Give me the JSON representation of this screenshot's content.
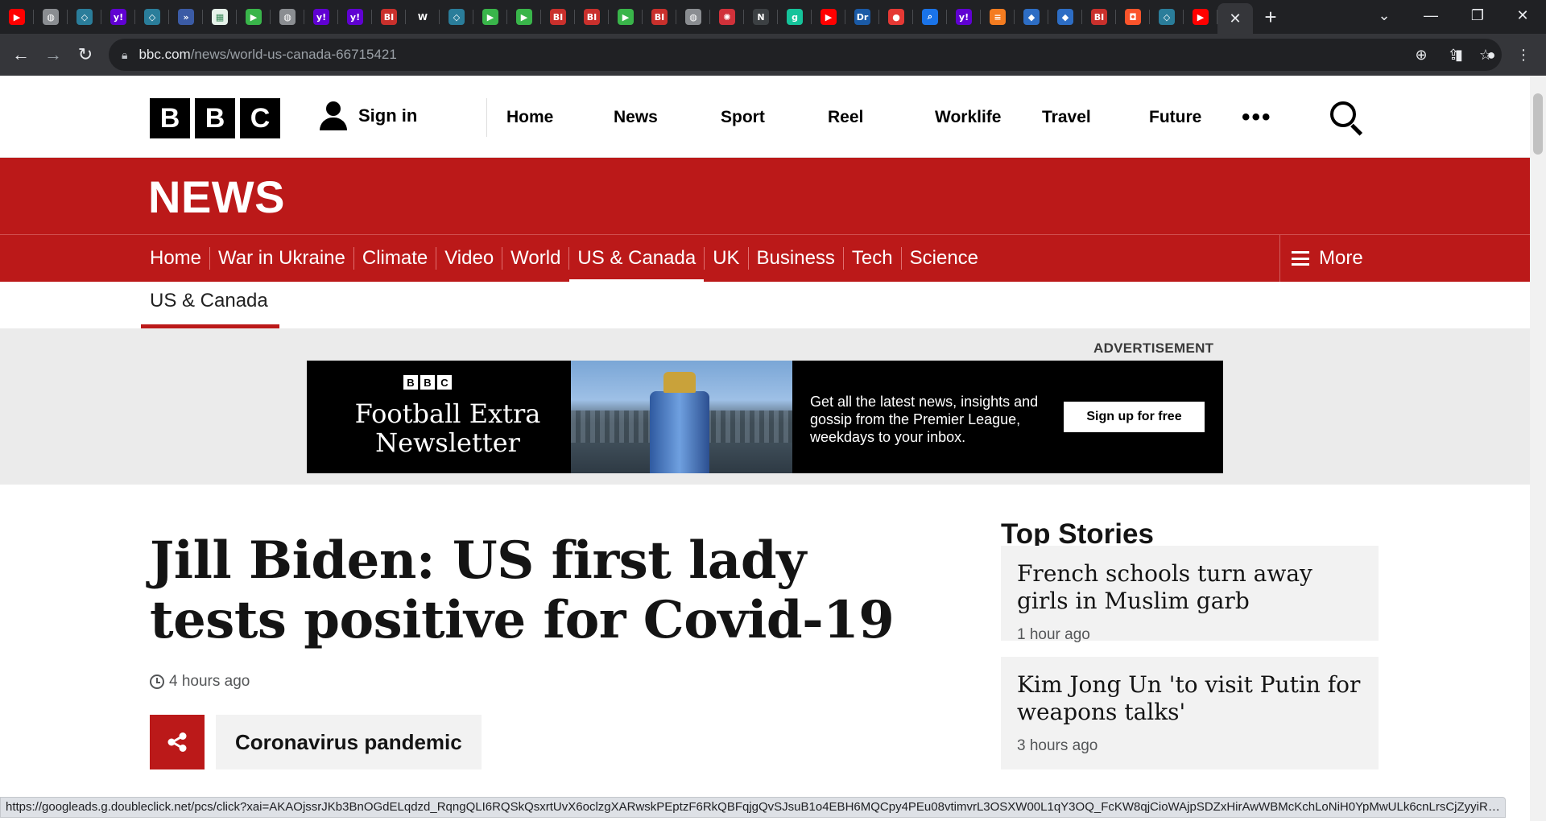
{
  "browser": {
    "tabs": [
      {
        "icon": "youtube-icon",
        "color": "#ff0000",
        "glyph": "▶"
      },
      {
        "icon": "globe-icon",
        "color": "#8a8d91",
        "glyph": "◍"
      },
      {
        "icon": "shield-icon",
        "color": "#2a7d9a",
        "glyph": "◇"
      },
      {
        "icon": "yahoo-icon",
        "color": "#6001d2",
        "glyph": "y!"
      },
      {
        "icon": "shield-icon",
        "color": "#2a7d9a",
        "glyph": "◇"
      },
      {
        "icon": "arrow-icon",
        "color": "#3b5ba5",
        "glyph": "»"
      },
      {
        "icon": "grid-icon",
        "color": "#e6f2ea",
        "glyph": "▦"
      },
      {
        "icon": "play-icon",
        "color": "#39b54a",
        "glyph": "▶"
      },
      {
        "icon": "globe-icon",
        "color": "#8a8d91",
        "glyph": "◍"
      },
      {
        "icon": "yahoo-icon",
        "color": "#6001d2",
        "glyph": "y!"
      },
      {
        "icon": "yahoo-icon",
        "color": "#6001d2",
        "glyph": "y!"
      },
      {
        "icon": "bi-icon",
        "color": "#c9302c",
        "glyph": "BI"
      },
      {
        "icon": "wsj-icon",
        "color": "#202124",
        "glyph": "W"
      },
      {
        "icon": "shield-icon",
        "color": "#2a7d9a",
        "glyph": "◇"
      },
      {
        "icon": "play-icon",
        "color": "#39b54a",
        "glyph": "▶"
      },
      {
        "icon": "play-icon",
        "color": "#39b54a",
        "glyph": "▶"
      },
      {
        "icon": "bi-icon",
        "color": "#c9302c",
        "glyph": "BI"
      },
      {
        "icon": "bi-icon",
        "color": "#c9302c",
        "glyph": "BI"
      },
      {
        "icon": "play-icon",
        "color": "#39b54a",
        "glyph": "▶"
      },
      {
        "icon": "bi-icon",
        "color": "#c9302c",
        "glyph": "BI"
      },
      {
        "icon": "globe-icon",
        "color": "#8a8d91",
        "glyph": "◍"
      },
      {
        "icon": "burst-icon",
        "color": "#d0313a",
        "glyph": "✺"
      },
      {
        "icon": "news-icon",
        "color": "#3c4043",
        "glyph": "N"
      },
      {
        "icon": "grammarly-icon",
        "color": "#15c39a",
        "glyph": "g"
      },
      {
        "icon": "youtube-icon",
        "color": "#ff0000",
        "glyph": "▶"
      },
      {
        "icon": "dr-icon",
        "color": "#1a5aa6",
        "glyph": "Dr"
      },
      {
        "icon": "mic-icon",
        "color": "#e53935",
        "glyph": "●"
      },
      {
        "icon": "search-icon",
        "color": "#1a73e8",
        "glyph": "⌕"
      },
      {
        "icon": "yahoo-icon",
        "color": "#6001d2",
        "glyph": "y!"
      },
      {
        "icon": "bars-icon",
        "color": "#f47c20",
        "glyph": "≡"
      },
      {
        "icon": "cube-icon",
        "color": "#2d6dc4",
        "glyph": "◆"
      },
      {
        "icon": "cube-icon",
        "color": "#2d6dc4",
        "glyph": "◆"
      },
      {
        "icon": "bi-icon",
        "color": "#c9302c",
        "glyph": "BI"
      },
      {
        "icon": "brave-icon",
        "color": "#fb542b",
        "glyph": "◘"
      },
      {
        "icon": "shield-icon",
        "color": "#2a7d9a",
        "glyph": "◇"
      },
      {
        "icon": "youtube-icon",
        "color": "#ff0000",
        "glyph": "▶"
      }
    ],
    "active_tab_close": "✕",
    "new_tab": "+",
    "window_controls": {
      "dropdown": "⌄",
      "minimize": "—",
      "restore": "❐",
      "close": "✕"
    },
    "nav": {
      "back": "←",
      "forward": "→",
      "reload": "↻"
    },
    "url_host": "bbc.com",
    "url_path": "/news/world-us-canada-66715421",
    "omnibox_icons": {
      "zoom": "⊕",
      "share": "⇪",
      "bookmark": "☆"
    },
    "toolbar_icons": {
      "sidepanel": "▮",
      "profile": "●",
      "menu": "⋮"
    },
    "status_url": "https://googleads.g.doubleclick.net/pcs/click?xai=AKAOjssrJKb3BnOGdELqdzd_RqngQLI6RQSkQsxrtUvX6oclzgXARwskPEptzF6RkQBFqjgQvSJsuB1o4EBH6MQCpy4PEu08vtimvrL3OSXW00L1qY3OQ_FcKW8qjCioWAjpSDZxHirAwWBMcKchLoNiH0YpMwULk6cnLrsCjZyyiR98v-HhWro4O..."
  },
  "masthead": {
    "logo": [
      "B",
      "B",
      "C"
    ],
    "sign_in": "Sign in",
    "nav": [
      "Home",
      "News",
      "Sport",
      "Reel",
      "Worklife",
      "Travel",
      "Future"
    ],
    "more_dots": "•••"
  },
  "news_bar": {
    "title": "NEWS"
  },
  "section_nav": {
    "items": [
      "Home",
      "War in Ukraine",
      "Climate",
      "Video",
      "World",
      "US & Canada",
      "UK",
      "Business",
      "Tech",
      "Science"
    ],
    "active": "US & Canada",
    "more": "More"
  },
  "sub_nav": {
    "current": "US & Canada"
  },
  "ad": {
    "label": "ADVERTISEMENT",
    "logo": [
      "B",
      "B",
      "C"
    ],
    "headline_line1": "Football Extra",
    "headline_line2": "Newsletter",
    "copy": "Get all the latest news, insights and gossip from the Premier League, weekdays to your inbox.",
    "cta": "Sign up for free"
  },
  "article": {
    "headline": "Jill Biden: US first lady tests positive for Covid-19",
    "timestamp": "4 hours ago",
    "topic": "Coronavirus pandemic"
  },
  "top_stories": {
    "heading": "Top Stories",
    "items": [
      {
        "title": "French schools turn away girls in Muslim garb",
        "time": "1 hour ago"
      },
      {
        "title": "Kim Jong Un 'to visit Putin for weapons talks'",
        "time": "3 hours ago"
      }
    ]
  },
  "colors": {
    "bbc_red": "#bb1919",
    "chrome_dark": "#202124",
    "chrome_mid": "#35363a"
  }
}
